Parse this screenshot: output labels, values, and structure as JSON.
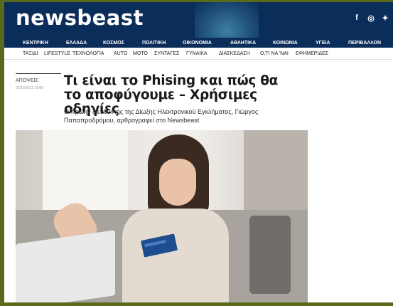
{
  "brand": {
    "logo": "newsbeast"
  },
  "social": [
    "f",
    "◎",
    "✦"
  ],
  "nav_primary": [
    "ΚΕΝΤΡΙΚΗ",
    "ΕΛΛΑΔΑ",
    "ΚΟΣΜΟΣ",
    "ΠΟΛΙΤΙΚΗ",
    "ΟΙΚΟΝΟΜΙΑ",
    "ΑΘΛΗΤΙΚΑ",
    "ΚΟΙΝΩΝΙΑ",
    "ΥΓΕΙΑ",
    "ΠΕΡΙΒΑΛΛΟΝ"
  ],
  "nav_secondary": [
    "ΤΑΞΙΔΙ",
    "LIFESTYLE",
    "ΤΕΧΝΟΛΟΓΙΑ",
    "AUTO",
    "MOTO",
    "ΣΥΝΤΑΓΕΣ",
    "ΓΥΝΑΙΚΑ",
    "ΔΙΑΣΚΕΔΑΣΗ",
    "Ο,ΤΙ ΝΑ 'ΝΑΙ",
    "ΕΦΗΜΕΡΙΔΕΣ"
  ],
  "article": {
    "section": "ΑΠΟΨΕΙΣ",
    "date": "22/10/2021 19:00",
    "title": "Τι είναι το Phising και πώς θα το αποφύγουμε – Χρήσιμες οδηγίες",
    "subtitle": "Ο πρώην διευθυντής της Δίωξης Ηλεκτρονικού Εγκλήματος, Γιώργος Παπαπροδρόμου, αρθρογραφεί στο Newsbeast"
  },
  "colors": {
    "header_bg": "#0b2d5a",
    "outer_bg": "#5a6a1c"
  }
}
